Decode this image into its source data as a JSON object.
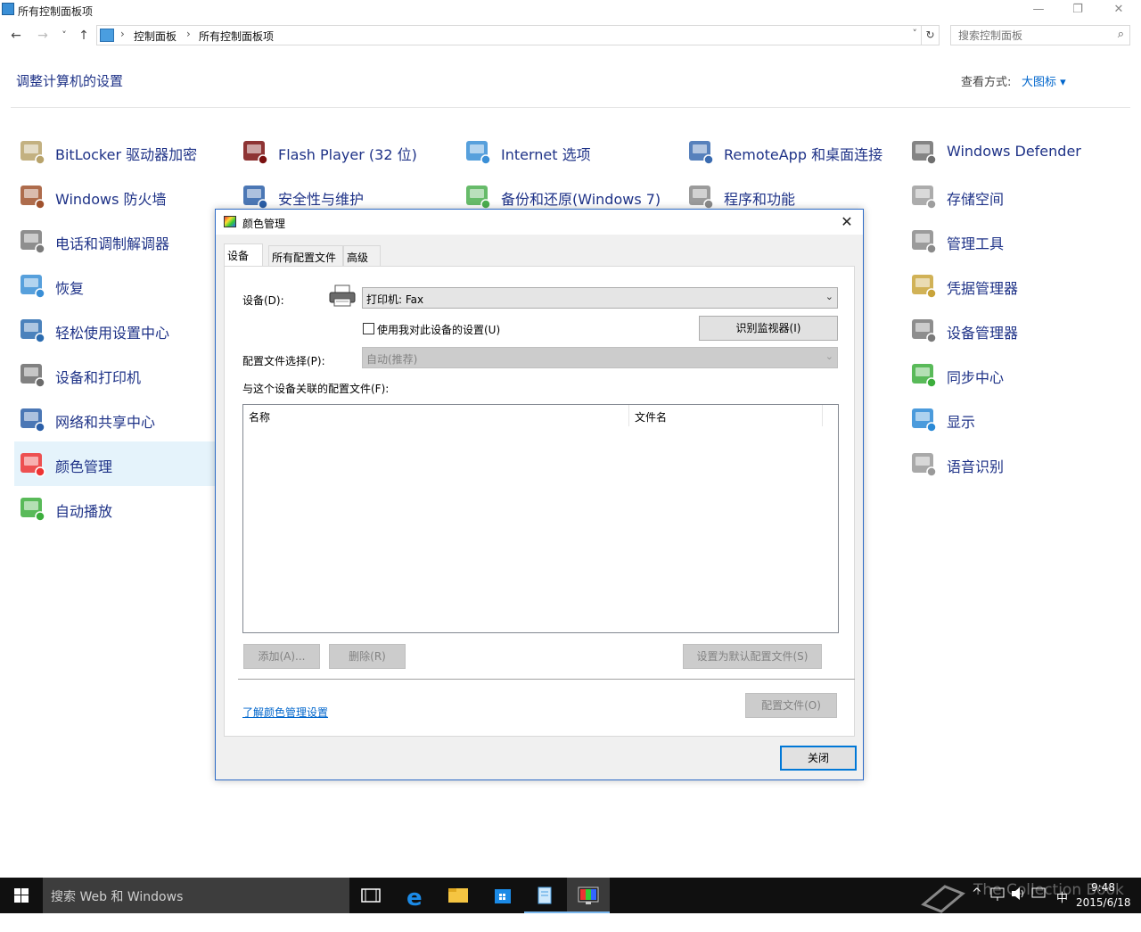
{
  "window": {
    "title": "所有控制面板项",
    "minimize_glyph": "—",
    "restore_glyph": "❐",
    "close_glyph": "✕"
  },
  "nav": {
    "back": "←",
    "forward": "→",
    "recent": "˅",
    "up": "↑"
  },
  "address": {
    "crumbs": [
      "控制面板",
      "所有控制面板项"
    ],
    "separator": "›",
    "dropdown": "˅",
    "refresh": "↻"
  },
  "search": {
    "placeholder": "搜索控制面板",
    "icon": "⌕"
  },
  "header": {
    "title": "调整计算机的设置",
    "view_by_label": "查看方式:",
    "view_by_value": "大图标 ▾"
  },
  "control_panel_items": [
    {
      "label": "BitLocker 驱动器加密",
      "icon": "bitlocker-icon"
    },
    {
      "label": "Flash Player (32 位)",
      "icon": "flash-icon"
    },
    {
      "label": "Internet 选项",
      "icon": "internet-options-icon"
    },
    {
      "label": "RemoteApp 和桌面连接",
      "icon": "remoteapp-icon"
    },
    {
      "label": "Windows Defender",
      "icon": "defender-icon"
    },
    {
      "label": "Windows 防火墙",
      "icon": "firewall-icon"
    },
    {
      "label": "安全性与维护",
      "icon": "security-flag-icon"
    },
    {
      "label": "备份和还原(Windows 7)",
      "icon": "backup-icon"
    },
    {
      "label": "程序和功能",
      "icon": "programs-icon"
    },
    {
      "label": "存储空间",
      "icon": "storage-icon"
    },
    {
      "label": "电话和调制解调器",
      "icon": "phone-modem-icon"
    },
    {
      "label": "管理工具",
      "icon": "admin-tools-icon"
    },
    {
      "label": "恢复",
      "icon": "recovery-icon"
    },
    {
      "label": "凭据管理器",
      "icon": "credential-icon"
    },
    {
      "label": "轻松使用设置中心",
      "icon": "ease-of-access-icon"
    },
    {
      "label": "设备管理器",
      "icon": "device-manager-icon"
    },
    {
      "label": "设备和打印机",
      "icon": "devices-printers-icon"
    },
    {
      "label": "同步中心",
      "icon": "sync-icon"
    },
    {
      "label": "网络和共享中心",
      "icon": "network-icon"
    },
    {
      "label": "显示",
      "icon": "display-icon"
    },
    {
      "label": "颜色管理",
      "icon": "color-management-icon",
      "selected": true
    },
    {
      "label": "语音识别",
      "icon": "microphone-icon"
    },
    {
      "label": "自动播放",
      "icon": "autoplay-icon"
    }
  ],
  "dialog": {
    "title": "颜色管理",
    "close_glyph": "✕",
    "tabs": [
      "设备",
      "所有配置文件",
      "高级"
    ],
    "active_tab": "设备",
    "device_label": "设备(D):",
    "device_value": "打印机: Fax",
    "use_my_settings_label": "使用我对此设备的设置(U)",
    "use_my_settings_checked": false,
    "identify_monitors_button": "识别监视器(I)",
    "profile_selection_label": "配置文件选择(P):",
    "profile_selection_value": "自动(推荐)",
    "associated_profiles_label": "与这个设备关联的配置文件(F):",
    "list_columns": [
      "名称",
      "文件名"
    ],
    "list_rows": [],
    "add_button": "添加(A)...",
    "remove_button": "删除(R)",
    "set_default_button": "设置为默认配置文件(S)",
    "learn_link": "了解颜色管理设置",
    "profiles_button": "配置文件(O)",
    "close_button": "关闭",
    "arrow": "⌄"
  },
  "taskbar": {
    "search_placeholder": "搜索 Web 和 Windows",
    "time": "9:48",
    "date": "2015/6/18",
    "ime": "中",
    "tray_up": "^",
    "watermark": "The Collection Book"
  }
}
